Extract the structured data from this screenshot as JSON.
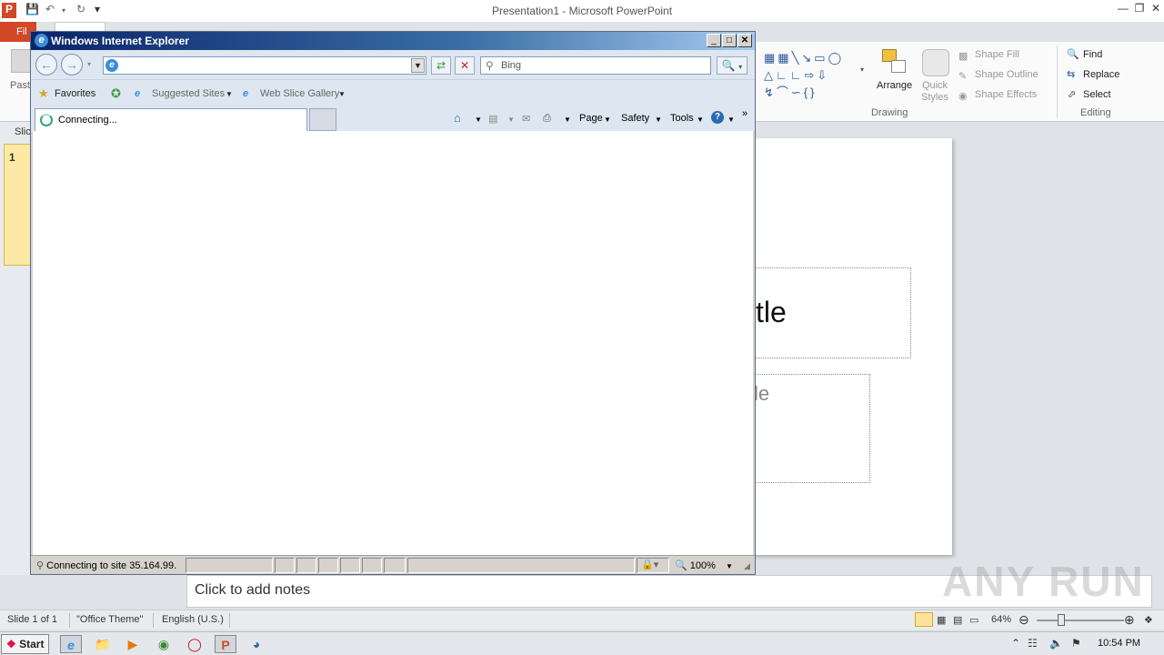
{
  "powerpoint": {
    "window_title": "Presentation1 - Microsoft PowerPoint",
    "file_tab": "Fil",
    "paste_label": "Past",
    "slides_tab": "Slic",
    "slide_number": "1",
    "ribbon": {
      "arrange": "Arrange",
      "quick_styles": "Quick Styles",
      "shape_fill": "Shape Fill",
      "shape_outline": "Shape Outline",
      "shape_effects": "Shape Effects",
      "drawing_group": "Drawing",
      "find": "Find",
      "replace": "Replace",
      "select": "Select",
      "editing_group": "Editing"
    },
    "slide": {
      "title_placeholder_visible": "tle",
      "subtitle_placeholder_visible": "le"
    },
    "notes_placeholder": "Click to add notes",
    "status": {
      "slide_info": "Slide 1 of 1",
      "theme": "\"Office Theme\"",
      "language": "English (U.S.)",
      "zoom": "64%"
    }
  },
  "ie": {
    "title": "Windows Internet Explorer",
    "address_value": "",
    "search_placeholder": "Bing",
    "favorites": "Favorites",
    "suggested_sites": "Suggested Sites",
    "web_slice_gallery": "Web Slice Gallery",
    "tab_label": "Connecting...",
    "commands": {
      "page": "Page",
      "safety": "Safety",
      "tools": "Tools"
    },
    "status_message": "Connecting to site 35.164.99.",
    "zoom": "100%"
  },
  "taskbar": {
    "start": "Start",
    "clock": "10:54 PM"
  },
  "watermark": "ANY RUN"
}
